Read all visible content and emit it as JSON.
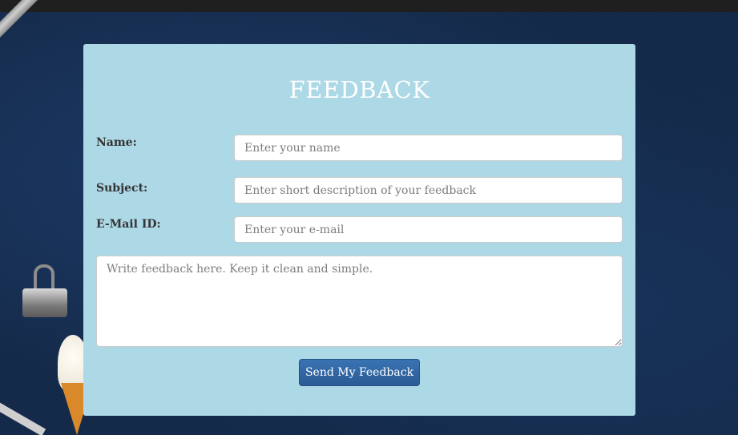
{
  "form": {
    "title": "FEEDBACK",
    "name_label": "Name:",
    "name_placeholder": "Enter your name",
    "subject_label": "Subject:",
    "subject_placeholder": "Enter short description of your feedback",
    "email_label": "E-Mail ID:",
    "email_placeholder": "Enter your e-mail",
    "feedback_placeholder": "Write feedback here. Keep it clean and simple.",
    "submit_label": "Send My Feedback"
  },
  "colors": {
    "card_background": "#add8e6",
    "button_background": "#2a5b94",
    "page_background": "#13294a"
  }
}
